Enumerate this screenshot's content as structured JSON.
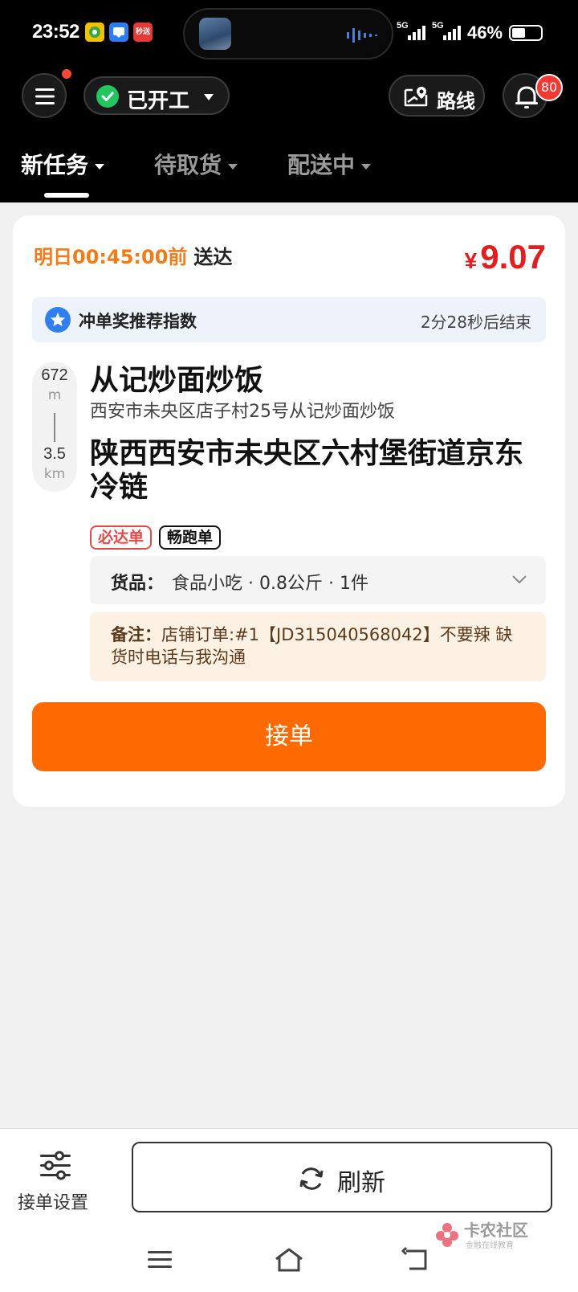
{
  "status_bar": {
    "time": "23:52",
    "apps": [
      {
        "icon": "lottery-app-icon",
        "color": "#f2c200",
        "text": ""
      },
      {
        "icon": "message-app-icon",
        "color": "#2d7cf6",
        "text": ""
      },
      {
        "icon": "express-app-icon",
        "color": "#e53935",
        "text": "秒送"
      }
    ],
    "network1": "5G",
    "network2": "5G",
    "battery_percent": "46%",
    "battery_level": 0.46
  },
  "header": {
    "work_status": "已开工",
    "route_label": "路线",
    "notification_count": "80"
  },
  "tabs": [
    {
      "label": "新任务",
      "active": true
    },
    {
      "label": "待取货",
      "active": false
    },
    {
      "label": "配送中",
      "active": false
    }
  ],
  "order": {
    "deadline_time": "明日00:45:00前",
    "deadline_suffix": "送达",
    "price_symbol": "¥",
    "price": "9.07",
    "bonus_label": "冲单奖推荐指数",
    "bonus_timer": "2分28秒后结束",
    "pickup_distance": "672",
    "pickup_unit": "m",
    "delivery_distance": "3.5",
    "delivery_unit": "km",
    "shop_name": "从记炒面炒饭",
    "shop_address": "西安市未央区店子村25号从记炒面炒饭",
    "destination": "陕西西安市未央区六村堡街道京东冷链",
    "tags": [
      "必达单",
      "畅跑单"
    ],
    "goods_key": "货品：",
    "goods_value": "食品小吃 · 0.8公斤 · 1件",
    "remark_key": "备注：",
    "remark_value": "店铺订单:#1【JD315040568042】不要辣 缺货时电话与我沟通",
    "accept_label": "接单"
  },
  "bottom": {
    "settings_label": "接单设置",
    "refresh_label": "刷新"
  },
  "watermark": {
    "title": "卡农社区",
    "subtitle": "金融在线教育"
  },
  "colors": {
    "accent": "#ff6a00",
    "price": "#e02020",
    "deadline": "#f07b1a"
  }
}
